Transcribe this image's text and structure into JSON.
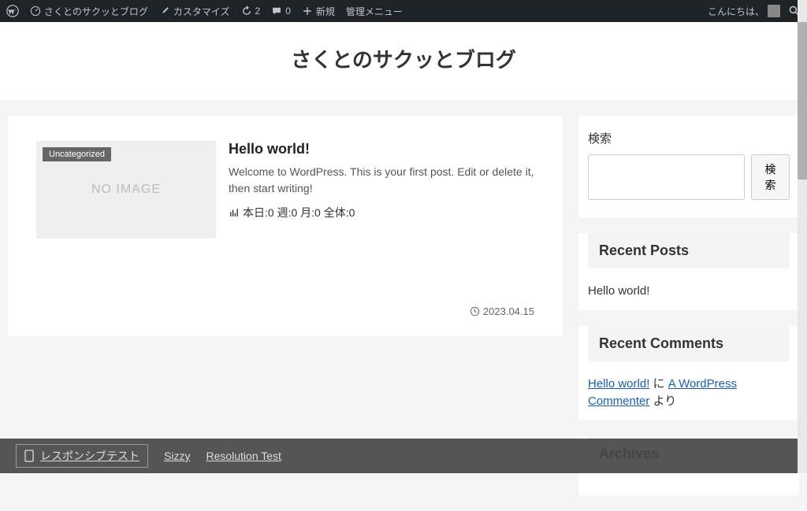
{
  "adminbar": {
    "site_name": "さくとのサクッとブログ",
    "customize": "カスタマイズ",
    "updates": "2",
    "comments": "0",
    "new": "新規",
    "admin_menu": "管理メニュー",
    "greeting": "こんにちは、"
  },
  "header": {
    "title": "さくとのサクッとブログ"
  },
  "post": {
    "category": "Uncategorized",
    "thumb_text": "NO IMAGE",
    "title": "Hello world!",
    "excerpt": "Welcome to WordPress. This is your first post. Edit or delete it, then start writing!",
    "stats": "本日:0 週:0 月:0 全体:0",
    "date": "2023.04.15"
  },
  "sidebar": {
    "search_label": "検索",
    "search_button": "検索",
    "recent_posts_title": "Recent Posts",
    "recent_posts": [
      {
        "title": "Hello world!"
      }
    ],
    "recent_comments_title": "Recent Comments",
    "recent_comments": {
      "post_link": "Hello world!",
      "connector": " に ",
      "author_link": "A WordPress Commenter",
      "suffix": " より"
    },
    "archives_title": "Archives"
  },
  "bottombar": {
    "label": "レスポンシブテスト",
    "link1": "Sizzy",
    "link2": "Resolution Test"
  }
}
